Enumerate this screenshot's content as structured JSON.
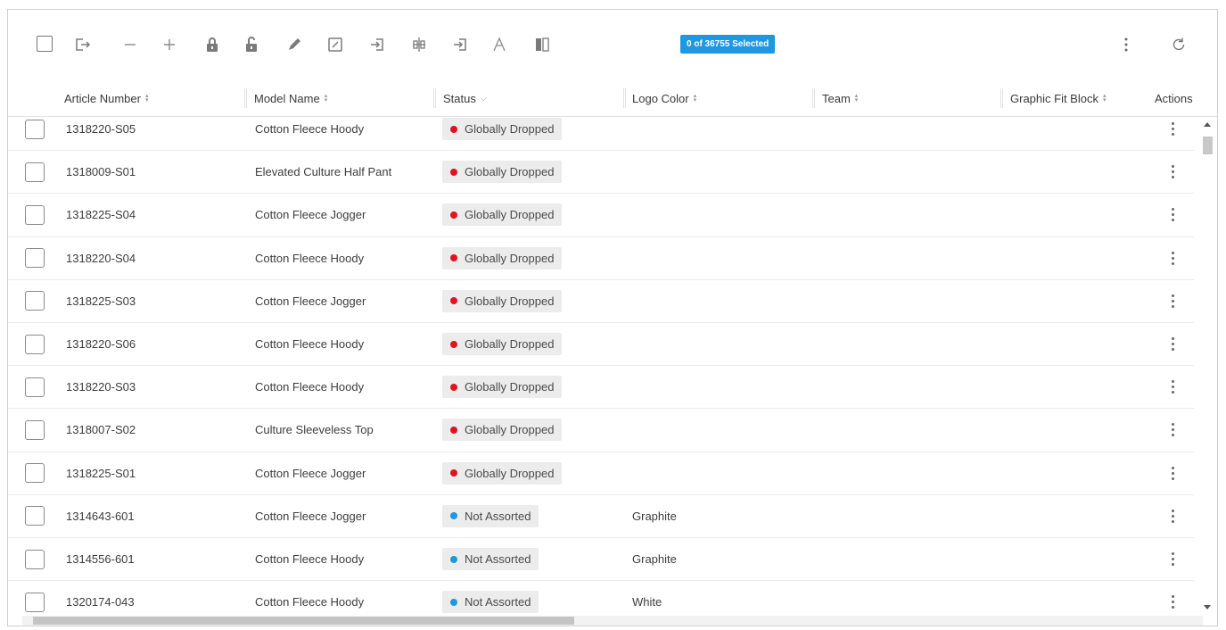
{
  "toolbar": {
    "selected_text": "0 of 36755 Selected",
    "icons": [
      "select-all-checkbox",
      "export-icon",
      "remove-icon",
      "add-icon",
      "lock-icon",
      "unlock-icon",
      "edit-icon",
      "edit-box-icon",
      "import-icon",
      "split-icon",
      "import-alt-icon",
      "font-icon",
      "compare-icon",
      "more-icon",
      "refresh-icon"
    ]
  },
  "header": {
    "article_number": "Article Number",
    "model_name": "Model Name",
    "status": "Status",
    "logo_color": "Logo Color",
    "team": "Team",
    "graphic_fit_block": "Graphic Fit Block",
    "actions": "Actions"
  },
  "colors": {
    "accent": "#1e98e0",
    "dropped_dot": "#e0141e",
    "not_assorted_dot": "#1e98e0"
  },
  "rows": [
    {
      "article": "1318220-S05",
      "model": "Cotton Fleece Hoody",
      "status": "Globally Dropped",
      "status_kind": "dropped",
      "logo_color": ""
    },
    {
      "article": "1318009-S01",
      "model": "Elevated Culture Half Pant",
      "status": "Globally Dropped",
      "status_kind": "dropped",
      "logo_color": ""
    },
    {
      "article": "1318225-S04",
      "model": "Cotton Fleece Jogger",
      "status": "Globally Dropped",
      "status_kind": "dropped",
      "logo_color": ""
    },
    {
      "article": "1318220-S04",
      "model": "Cotton Fleece Hoody",
      "status": "Globally Dropped",
      "status_kind": "dropped",
      "logo_color": ""
    },
    {
      "article": "1318225-S03",
      "model": "Cotton Fleece Jogger",
      "status": "Globally Dropped",
      "status_kind": "dropped",
      "logo_color": ""
    },
    {
      "article": "1318220-S06",
      "model": "Cotton Fleece Hoody",
      "status": "Globally Dropped",
      "status_kind": "dropped",
      "logo_color": ""
    },
    {
      "article": "1318220-S03",
      "model": "Cotton Fleece Hoody",
      "status": "Globally Dropped",
      "status_kind": "dropped",
      "logo_color": ""
    },
    {
      "article": "1318007-S02",
      "model": "Culture Sleeveless Top",
      "status": "Globally Dropped",
      "status_kind": "dropped",
      "logo_color": ""
    },
    {
      "article": "1318225-S01",
      "model": "Cotton Fleece Jogger",
      "status": "Globally Dropped",
      "status_kind": "dropped",
      "logo_color": ""
    },
    {
      "article": "1314643-601",
      "model": "Cotton Fleece Jogger",
      "status": "Not Assorted",
      "status_kind": "not_assorted",
      "logo_color": "Graphite"
    },
    {
      "article": "1314556-601",
      "model": "Cotton Fleece Hoody",
      "status": "Not Assorted",
      "status_kind": "not_assorted",
      "logo_color": "Graphite"
    },
    {
      "article": "1320174-043",
      "model": "Cotton Fleece Hoody",
      "status": "Not Assorted",
      "status_kind": "not_assorted",
      "logo_color": "White"
    }
  ]
}
